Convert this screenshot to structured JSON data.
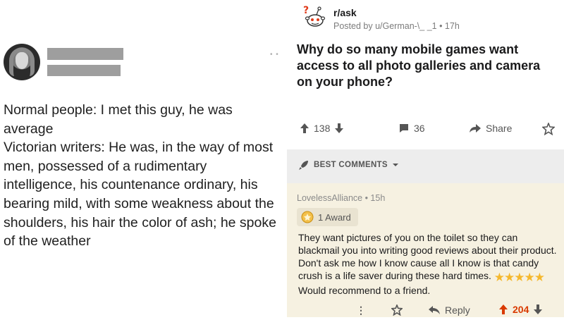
{
  "tweet": {
    "text": "Normal people: I met this guy, he was average\nVictorian writers: He was, in the way of most men, possessed of a rudimentary intelligence, his countenance ordinary, his bearing mild, with some weakness about the shoulders, his hair the color of ash; he spoke of the weather",
    "more_icon": "more-dots-icon"
  },
  "reddit": {
    "subreddit": "r/ask",
    "posted_by": "Posted by u/German-\\_ _1 • 17h",
    "title": "Why do so many mobile games want access to all photo galleries and camera on your phone?",
    "votes": "138",
    "comments": "36",
    "share_label": "Share",
    "best_comments_label": "BEST COMMENTS",
    "comment": {
      "author": "LovelessAlliance • 15h",
      "award_label": "1 Award",
      "body_part1": "They want pictures of you on the toilet so they can blackmail you into writing good reviews about their product. Don't ask me how I know cause all I know is that candy crush is a life saver during these hard times.",
      "stars": "★★★★★",
      "star_rating": 5,
      "body_part2": "Would recommend to a friend.",
      "reply_label": "Reply",
      "votes": "204"
    },
    "colors": {
      "upvote_active": "#d93a00",
      "star": "#f5b82e",
      "comment_bg": "#f6f1e1"
    }
  }
}
